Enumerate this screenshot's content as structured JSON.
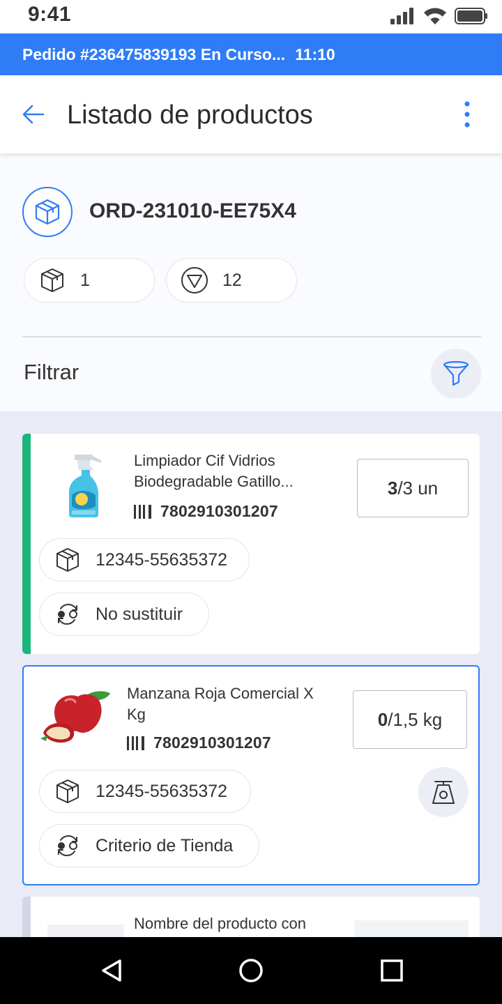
{
  "status_bar": {
    "time": "9:41",
    "icons": [
      "signal-icon",
      "wifi-icon",
      "battery-icon"
    ]
  },
  "banner": {
    "order_text": "Pedido #236475839193 En Curso...",
    "time": "11:10",
    "color": "#2f7cf6"
  },
  "app_bar": {
    "title": "Listado de productos",
    "back_icon": "arrow-left-icon",
    "menu_icon": "more-vertical-icon"
  },
  "order": {
    "id": "ORD-231010-EE75X4",
    "packages_count": "1",
    "items_count": "12",
    "filter_label": "Filtrar"
  },
  "products": [
    {
      "name": "Limpiador Cif Vidrios Biodegradable Gatillo...",
      "barcode": "7802910301207",
      "qty_picked": "3",
      "qty_rest": "/3 un",
      "package_code": "12345-55635372",
      "substitution": "No sustituir",
      "status_color": "#1cb67a"
    },
    {
      "name": "Manzana Roja Comercial X Kg",
      "barcode": "7802910301207",
      "qty_picked": "0",
      "qty_rest": "/1,5 kg",
      "package_code": "12345-55635372",
      "substitution": "Criterio de Tienda",
      "status_color": "#2f7cf6"
    },
    {
      "name": "Nombre del producto con"
    }
  ]
}
